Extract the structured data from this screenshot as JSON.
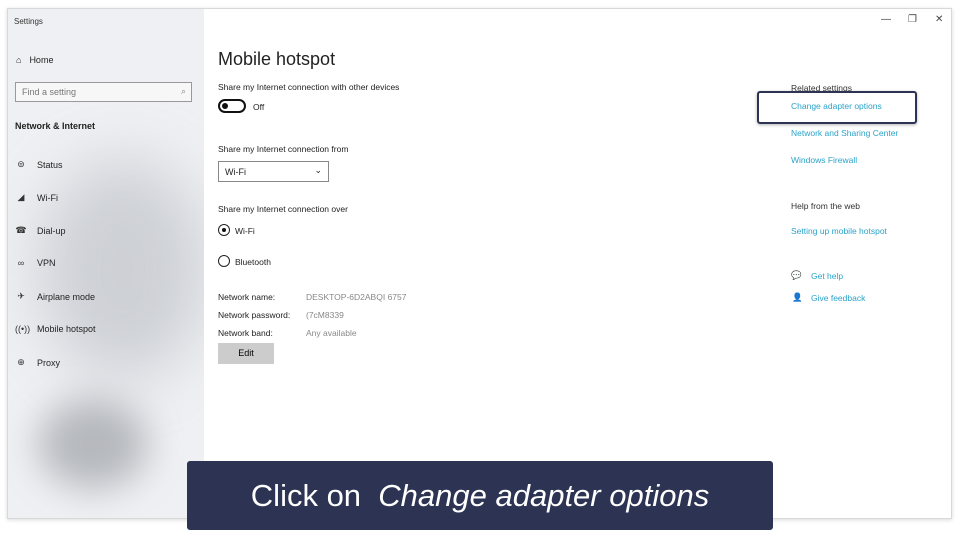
{
  "window": {
    "title": "Settings",
    "controls": [
      "minimize",
      "maximize",
      "close"
    ]
  },
  "sidebar": {
    "home": "Home",
    "search_placeholder": "Find a setting",
    "section": "Network & Internet",
    "items": [
      {
        "label": "Status",
        "icon": "status-globe-icon"
      },
      {
        "label": "Wi-Fi",
        "icon": "wifi-icon"
      },
      {
        "label": "Dial-up",
        "icon": "phone-icon"
      },
      {
        "label": "VPN",
        "icon": "vpn-icon"
      },
      {
        "label": "Airplane mode",
        "icon": "airplane-icon"
      },
      {
        "label": "Mobile hotspot",
        "icon": "hotspot-icon"
      },
      {
        "label": "Proxy",
        "icon": "globe-icon"
      }
    ]
  },
  "main": {
    "title": "Mobile hotspot",
    "share_label": "Share my Internet connection with other devices",
    "toggle_state": "Off",
    "from_label": "Share my Internet connection from",
    "from_value": "Wi-Fi",
    "over_label": "Share my Internet connection over",
    "over_options": [
      "Wi-Fi",
      "Bluetooth"
    ],
    "over_selected": "Wi-Fi",
    "name_label": "Network name:",
    "name_value": "DESKTOP-6D2ABQI 6757",
    "password_label": "Network password:",
    "password_value": "(7cM8339",
    "band_label": "Network band:",
    "band_value": "Any available",
    "edit": "Edit"
  },
  "related": {
    "title": "Related settings",
    "links": [
      "Change adapter options",
      "Network and Sharing Center",
      "Windows Firewall"
    ],
    "help_title": "Help from the web",
    "help_link": "Setting up mobile hotspot",
    "get_help": "Get help",
    "feedback": "Give feedback"
  },
  "banner": {
    "prefix": "Click on ",
    "emphasis": "Change adapter options"
  },
  "colors": {
    "link": "#2aa3c9",
    "banner": "#2c3353"
  }
}
